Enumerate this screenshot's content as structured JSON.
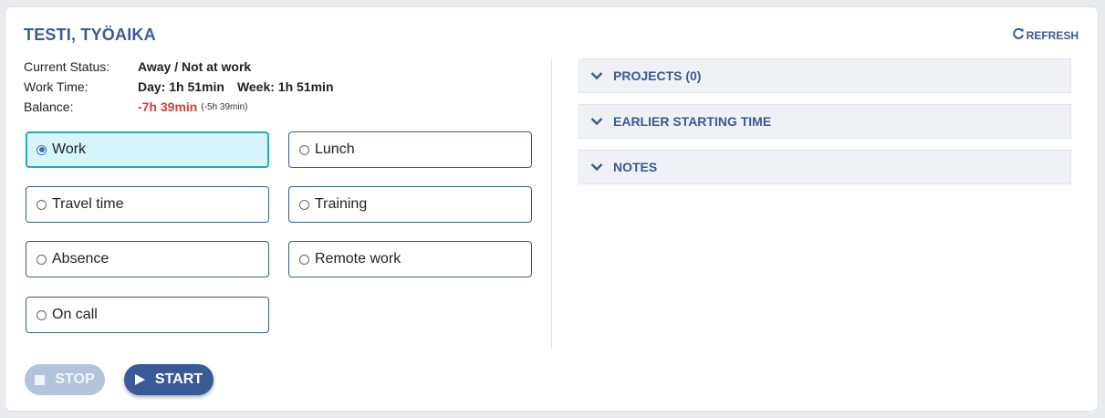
{
  "header": {
    "title": "TESTI, TYÖAIKA",
    "refresh_label": "REFRESH"
  },
  "status": {
    "current_status_label": "Current Status:",
    "current_status_value": "Away / Not at work",
    "work_time_label": "Work Time:",
    "day_value": "Day: 1h 51min",
    "week_value": "Week: 1h 51min",
    "balance_label": "Balance:",
    "balance_value": "-7h 39min",
    "balance_secondary": "(-5h 39min)"
  },
  "activity_options": [
    {
      "label": "Work",
      "selected": true
    },
    {
      "label": "Lunch",
      "selected": false
    },
    {
      "label": "Travel time",
      "selected": false
    },
    {
      "label": "Training",
      "selected": false
    },
    {
      "label": "Absence",
      "selected": false
    },
    {
      "label": "Remote work",
      "selected": false
    },
    {
      "label": "On call",
      "selected": false
    }
  ],
  "panels": [
    {
      "label": "PROJECTS (0)"
    },
    {
      "label": "EARLIER STARTING TIME"
    },
    {
      "label": "NOTES"
    }
  ],
  "actions": {
    "stop_label": "STOP",
    "start_label": "START"
  },
  "colors": {
    "accent": "#3a5a96",
    "selected_bg": "#d8f5fb",
    "selected_border": "#22a7c4",
    "negative": "#c9403a",
    "disabled_button": "#b3c3d9"
  }
}
